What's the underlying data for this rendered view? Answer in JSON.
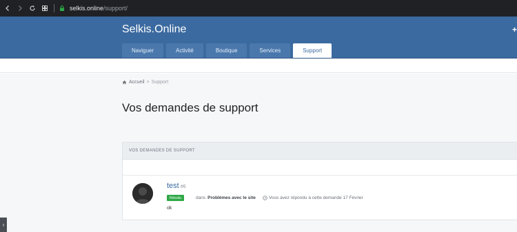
{
  "browser": {
    "url_domain": "selkis.online",
    "url_path": "/support/"
  },
  "site": {
    "brand": "Selkis.Online",
    "plus": "+"
  },
  "tabs": [
    {
      "label": "Naviguer"
    },
    {
      "label": "Activité"
    },
    {
      "label": "Boutique"
    },
    {
      "label": "Services"
    },
    {
      "label": "Support",
      "active": true
    }
  ],
  "breadcrumb": {
    "home": "Accueil",
    "current": "Support"
  },
  "page": {
    "title": "Vos demandes de support"
  },
  "panel": {
    "header": "VOS DEMANDES DE SUPPORT",
    "request": {
      "title": "test",
      "number": "#6",
      "status": "Résolu",
      "in_label": "dans",
      "category": "Problèmes avec le site",
      "reply_info": "Vous avez répondu à cette demande 17 Février",
      "body": "ok"
    }
  },
  "colors": {
    "header_bg": "#3b6aa0",
    "badge_resolved": "#2ea846",
    "link": "#3b6aa0"
  }
}
